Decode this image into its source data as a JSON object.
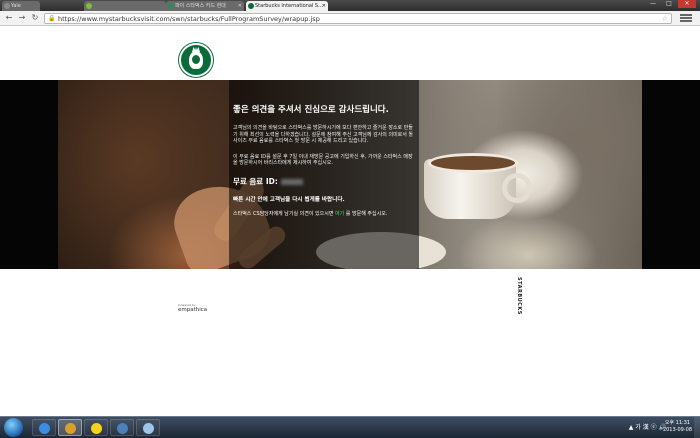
{
  "tabs": [
    {
      "label": "Yale",
      "color": "#8a8a8a"
    },
    {
      "label": "",
      "color": "#7dbd3b"
    },
    {
      "label": "파이 스타벅스 카드 현대",
      "color": "#2e8b57"
    },
    {
      "label": "Starbucks International S...",
      "color": "#0b6b3a"
    }
  ],
  "window_buttons": {
    "minimize": "—",
    "maximize": "□",
    "close": "✕"
  },
  "browser": {
    "url": "https://www.mystarbucksvisit.com/swn/starbucks/FullProgramSurvey/wrapup.jsp",
    "back": "←",
    "forward": "→",
    "reload": "↻"
  },
  "message": {
    "title": "좋은 의견을 주셔서 진심으로 감사드립니다.",
    "para1": "고객님의 의견을 바탕으로 스타벅스를 방문하시기에 보다 편안하고 즐거운 장소로 만들기 위해 최선의 노력을 다하겠습니다. 설문에 참여해 주신 고객님께 감사의 의미로서 톨 사이즈 무료 음료를 스타벅스 첫 방문 시 제공해 드리고 있습니다.",
    "para2": "이 무료 음료 ID를 설문 후 7일 이내 재방문 공고에 기입하신 후, 가까운 스타벅스 매장을 방문하시어 바리스타에게 제시하여 주십시오.",
    "free_label": "무료 음료 ID:",
    "hint": "빠른 시간 안에 고객님을 다시 뵙게를 바랍니다.",
    "contact_before": "스타벅스 CS담당자에게 남기실 의견이 있으시면 ",
    "contact_link": "여기",
    "contact_after": " 를 방문해 주십시오."
  },
  "footer": {
    "powered_by": "powered by",
    "brand": "empathica",
    "vertical_logo": "STARBUCKS"
  },
  "taskbar": {
    "apps": [
      {
        "name": "ie",
        "color": "#3a8de0"
      },
      {
        "name": "chrome",
        "color": "#d9a12b"
      },
      {
        "name": "kakaotalk",
        "color": "#f5d21c"
      },
      {
        "name": "media",
        "color": "#4f7fb8"
      },
      {
        "name": "notes",
        "color": "#9fc6e8"
      }
    ],
    "tray": "▲ 가 漢 ⓔ 🔊",
    "time": "오후 11:31",
    "date": "2013-09-08"
  }
}
